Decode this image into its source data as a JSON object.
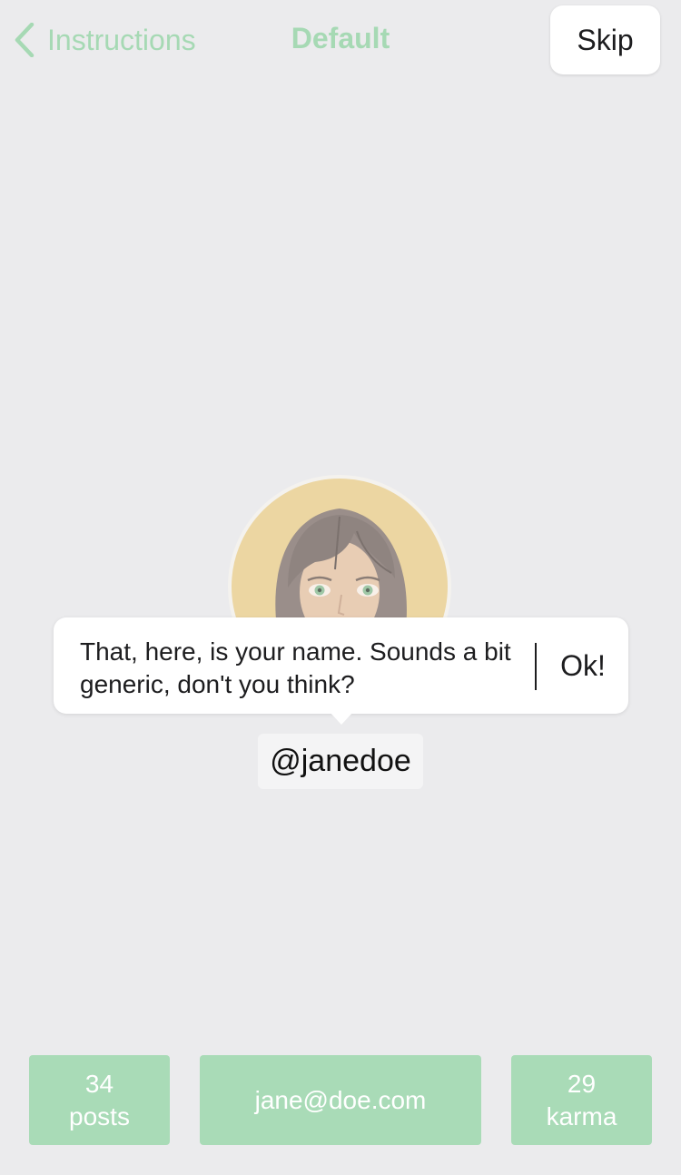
{
  "nav": {
    "back_label": "Instructions",
    "title": "Default",
    "skip_label": "Skip",
    "accent_color": "#a6d9b4"
  },
  "tooltip": {
    "text": "That, here, is your name. Sounds a bit generic, don't you think?",
    "ok_label": "Ok!"
  },
  "profile": {
    "username": "@janedoe",
    "avatar_icon": "woman-avatar-icon"
  },
  "stats": {
    "posts": {
      "value": "34",
      "label": "posts"
    },
    "email": "jane@doe.com",
    "karma": {
      "value": "29",
      "label": "karma"
    },
    "color": "#a9dbb7"
  }
}
